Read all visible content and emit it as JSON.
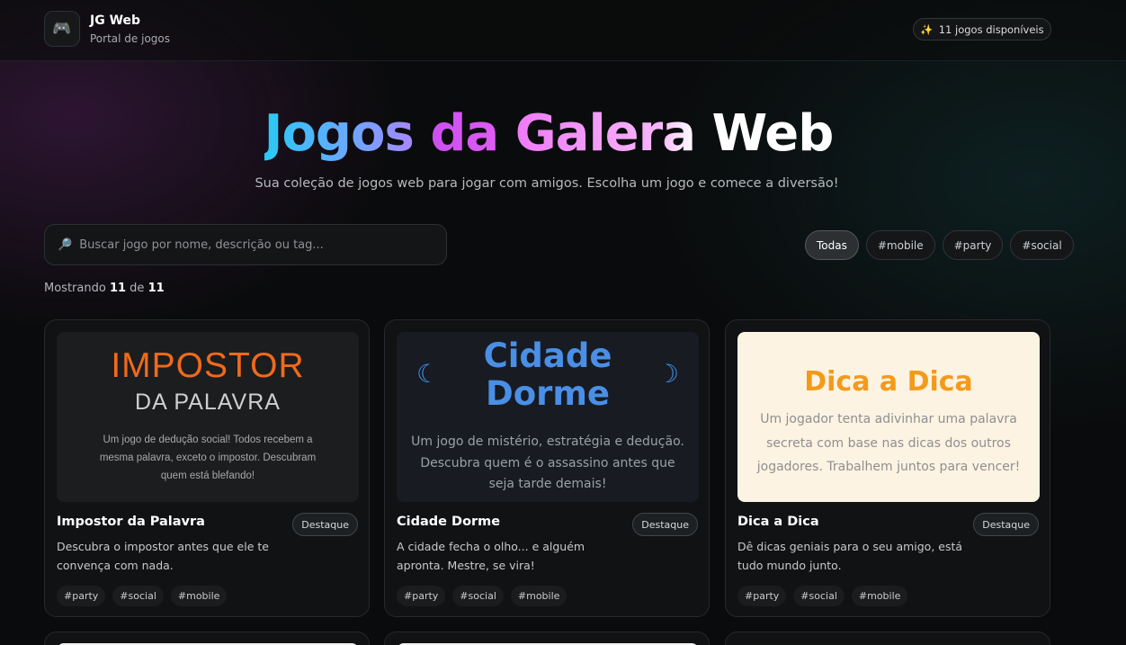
{
  "header": {
    "brand_icon": "gamepad-icon",
    "brand_title": "JG Web",
    "brand_subtitle": "Portal de jogos",
    "count_icon": "sparkles-icon",
    "count_label": "11 jogos disponíveis"
  },
  "hero": {
    "title_part1": "Jogos",
    "title_part2": "da",
    "title_part3": "Galera",
    "title_part4": "Web",
    "subtitle": "Sua coleção de jogos web para jogar com amigos. Escolha um jogo e comece a diversão!"
  },
  "search": {
    "icon": "magnifier-icon",
    "placeholder": "Buscar jogo por nome, descrição ou tag...",
    "value": ""
  },
  "filters": [
    "Todas",
    "#mobile",
    "#party",
    "#social"
  ],
  "active_filter": "Todas",
  "results": {
    "prefix": "Mostrando",
    "shown": "11",
    "sep": "de",
    "total": "11"
  },
  "cards": [
    {
      "thumb_line1": "IMPOSTOR",
      "thumb_line2": "DA PALAVRA",
      "thumb_desc": "Um jogo de dedução social! Todos recebem a mesma palavra, exceto o impostor. Descubram quem está blefando!",
      "title": "Impostor da Palavra",
      "badge": "Destaque",
      "desc": "Descubra o impostor antes que ele te convença com nada.",
      "tags": [
        "#party",
        "#social",
        "#mobile"
      ]
    },
    {
      "thumb_line1": "Cidade",
      "thumb_line2": "Dorme",
      "thumb_desc": "Um jogo de mistério, estratégia e dedução. Descubra quem é o assassino antes que seja tarde demais!",
      "title": "Cidade Dorme",
      "badge": "Destaque",
      "desc": "A cidade fecha o olho... e alguém apronta. Mestre, se vira!",
      "tags": [
        "#party",
        "#social",
        "#mobile"
      ]
    },
    {
      "thumb_line1": "Dica a Dica",
      "thumb_desc": "Um jogador tenta adivinhar uma palavra secreta com base nas dicas dos outros jogadores. Trabalhem juntos para vencer!",
      "title": "Dica a Dica",
      "badge": "Destaque",
      "desc": "Dê dicas geniais para o seu amigo, está tudo mundo junto.",
      "tags": [
        "#party",
        "#social",
        "#mobile"
      ]
    }
  ],
  "colors": {
    "background": "#0a0b0c",
    "impostor_orange": "#f06a1c",
    "cidade_blue": "#4a8fe6",
    "dica_orange": "#f49a1a"
  }
}
